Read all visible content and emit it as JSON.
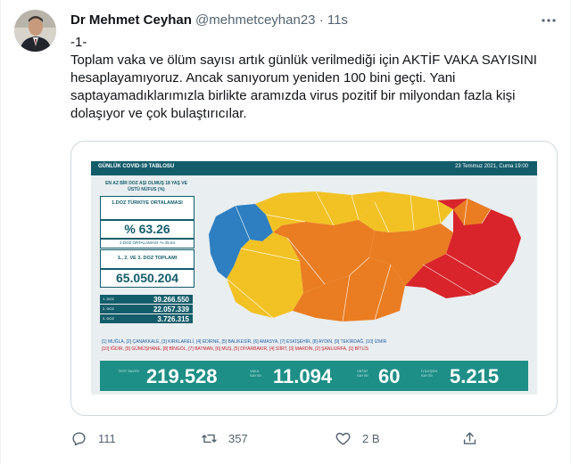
{
  "tweet": {
    "author": {
      "name": "Dr Mehmet Ceyhan",
      "handle": "@mehmetceyhan23",
      "separator": "·",
      "time": "11s"
    },
    "text_lines": [
      "-1-",
      "Toplam vaka ve ölüm sayısı artık günlük verilmediği için AKTİF VAKA SAYISINI hesaplayamıyoruz. Ancak sanıyorum yeniden 100 bini geçti. Yani saptayamadıklarımızla birlikte aramızda virus pozitif bir milyondan fazla kişi dolaşıyor ve çok bulaştırıcılar."
    ],
    "more_icon": "more-dots-icon",
    "actions": {
      "reply_count": "111",
      "retweet_count": "357",
      "like_count": "2 B",
      "reply_icon": "reply-icon",
      "retweet_icon": "retweet-icon",
      "like_icon": "heart-icon",
      "share_icon": "share-icon"
    }
  },
  "infographic": {
    "title": "GÜNLÜK COVID-19 TABLOSU",
    "date": "23 Temmuz 2021, Cuma 19:00",
    "left_title": "EN AZ BİR DOZ AŞI OLMUŞ 18 YAŞ VE ÜSTÜ NÜFUS (%)",
    "avg1_label": "1.DOZ TÜRKİYE ORTALAMASI",
    "avg1_value": "% 63.26",
    "avg2_label": "2.DOZ ORTALAMASI: % 35.54",
    "total_label": "1., 2. VE 3. DOZ TOPLAMI",
    "total_value": "65.050.204",
    "dose_rows": [
      {
        "label": "1. DOZ",
        "value": "39.266.550"
      },
      {
        "label": "2. DOZ",
        "value": "22.057.339"
      },
      {
        "label": "3. DOZ",
        "value": "3.726.315"
      }
    ],
    "legend_line1": "[1] MUĞLA, [2] ÇANAKKALE, [3] KIRKLARELİ, [4] EDİRNE, [5] BALIKESİR, [6] AMASYA, [7] ESKİŞEHİR, [8] AYDIN, [9] TEKİRDAĞ, [10] İZMİR",
    "legend_line2": "[10] IĞDIR, [9] GÜMÜŞHANE, [8] BİNGÖL, [7] BATMAN, [6] MUŞ, [5] DİYARBAKIR, [4] SİİRT, [3] MARDİN, [2] ŞANLIURFA, [1] BİTLİS",
    "stats": [
      {
        "label": "TEST SAYISI",
        "value": "219.528"
      },
      {
        "label": "VAKA SAYISI",
        "value": "11.094"
      },
      {
        "label": "VEFAT SAYISI",
        "value": "60"
      },
      {
        "label": "İYİLEŞEN SAYISI",
        "value": "5.215"
      }
    ],
    "colors": {
      "dark_teal": "#135d6b",
      "bar_teal": "#1e8f86",
      "blue": "#2e7fc1",
      "yellow": "#f2c224",
      "orange": "#ea7d22",
      "red": "#d8242a"
    }
  }
}
